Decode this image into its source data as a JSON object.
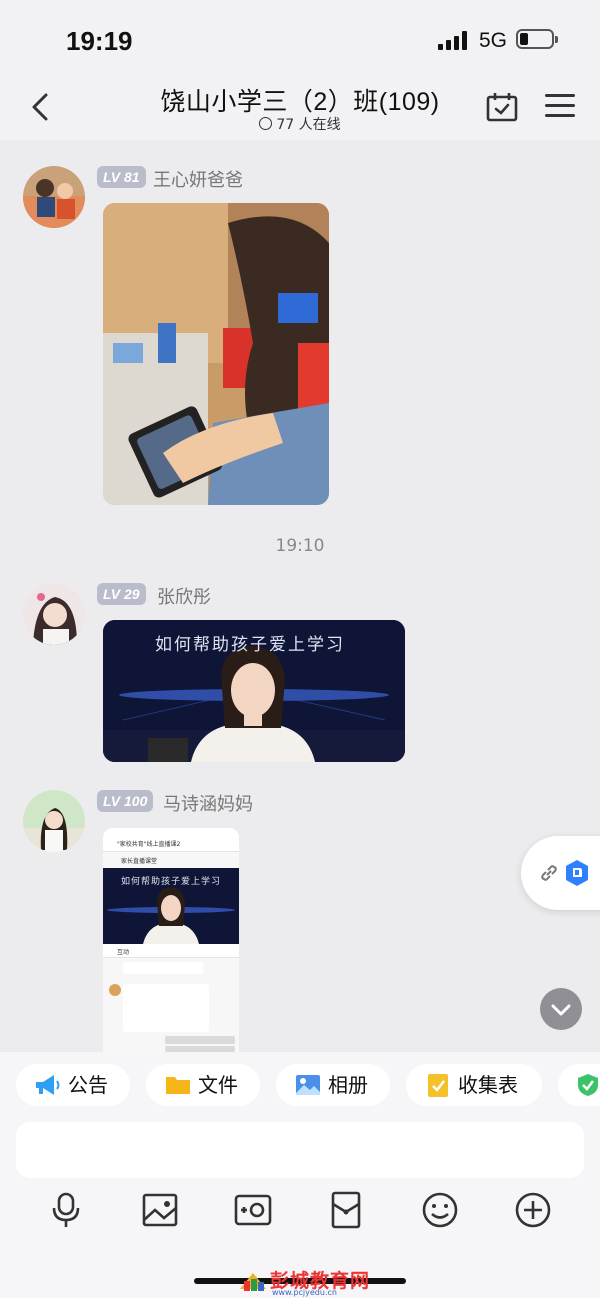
{
  "status": {
    "time": "19:19",
    "network": "5G"
  },
  "header": {
    "title": "饶山小学三（2）班(109)",
    "online": "77 人在线"
  },
  "messages": [
    {
      "level": "LV 81",
      "name": "王心妍爸爸",
      "type": "image"
    },
    {
      "level": "LV 29",
      "name": "张欣彤",
      "type": "video",
      "video_caption": "如何帮助孩子爱上学习"
    },
    {
      "level": "LV 100",
      "name": "马诗涵妈妈",
      "type": "screenshot",
      "screenshot": {
        "header": "\"家校共育\"线上直播课2",
        "channel": "家长直播课堂",
        "caption": "如何帮助孩子爱上学习",
        "tab": "互动"
      }
    }
  ],
  "timestamp": "19:10",
  "quick_actions": [
    {
      "label": "公告",
      "icon": "megaphone-icon"
    },
    {
      "label": "文件",
      "icon": "folder-icon"
    },
    {
      "label": "相册",
      "icon": "album-icon"
    },
    {
      "label": "收集表",
      "icon": "form-icon"
    }
  ],
  "toolbar": [
    "microphone-icon",
    "image-icon",
    "video-icon",
    "red-packet-icon",
    "emoji-icon",
    "plus-icon"
  ],
  "watermark": {
    "text": "彭城教育网",
    "url": "www.pcjyedu.cn"
  },
  "colors": {
    "background": "#ececef",
    "level_badge": "#b9bccb",
    "accent_blue": "#2f80ff"
  }
}
